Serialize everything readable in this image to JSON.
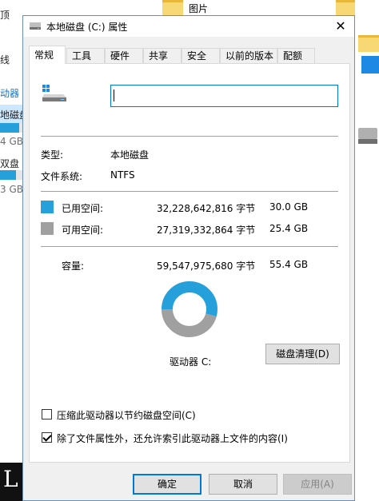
{
  "background": {
    "left_texts": [
      "顶",
      "线",
      "动器",
      "地磁盘",
      "4 GB",
      "双盘",
      "3 GB"
    ],
    "black_text": "L",
    "right_text": "图片"
  },
  "dialog": {
    "title": "本地磁盘 (C:) 属性",
    "close_glyph": "✕",
    "tabs": [
      {
        "label": "常规",
        "active": true
      },
      {
        "label": "工具",
        "active": false
      },
      {
        "label": "硬件",
        "active": false
      },
      {
        "label": "共享",
        "active": false
      },
      {
        "label": "安全",
        "active": false
      },
      {
        "label": "以前的版本",
        "active": false
      },
      {
        "label": "配额",
        "active": false
      }
    ],
    "name_input": {
      "value": "",
      "placeholder": ""
    },
    "type": {
      "label": "类型:",
      "value": "本地磁盘"
    },
    "filesystem": {
      "label": "文件系统:",
      "value": "NTFS"
    },
    "used": {
      "label": "已用空间:",
      "bytes": "32,228,642,816 字节",
      "size": "30.0 GB",
      "color": "#26a0da"
    },
    "free": {
      "label": "可用空间:",
      "bytes": "27,319,332,864 字节",
      "size": "25.4 GB",
      "color": "#a0a0a0"
    },
    "capacity": {
      "label": "容量:",
      "bytes": "59,547,975,680 字节",
      "size": "55.4 GB"
    },
    "chart_data": {
      "type": "pie",
      "categories": [
        "已用空间",
        "可用空间"
      ],
      "values": [
        32228642816,
        27319332864
      ],
      "colors": [
        "#26a0da",
        "#a0a0a0"
      ]
    },
    "drive_label": "驱动器 C:",
    "cleanup_button": "磁盘清理(D)",
    "compress_option": {
      "label": "压缩此驱动器以节约磁盘空间(C)",
      "checked": false
    },
    "index_option": {
      "label": "除了文件属性外，还允许索引此驱动器上文件的内容(I)",
      "checked": true
    },
    "buttons": {
      "ok": "确定",
      "cancel": "取消",
      "apply": "应用(A)"
    }
  }
}
